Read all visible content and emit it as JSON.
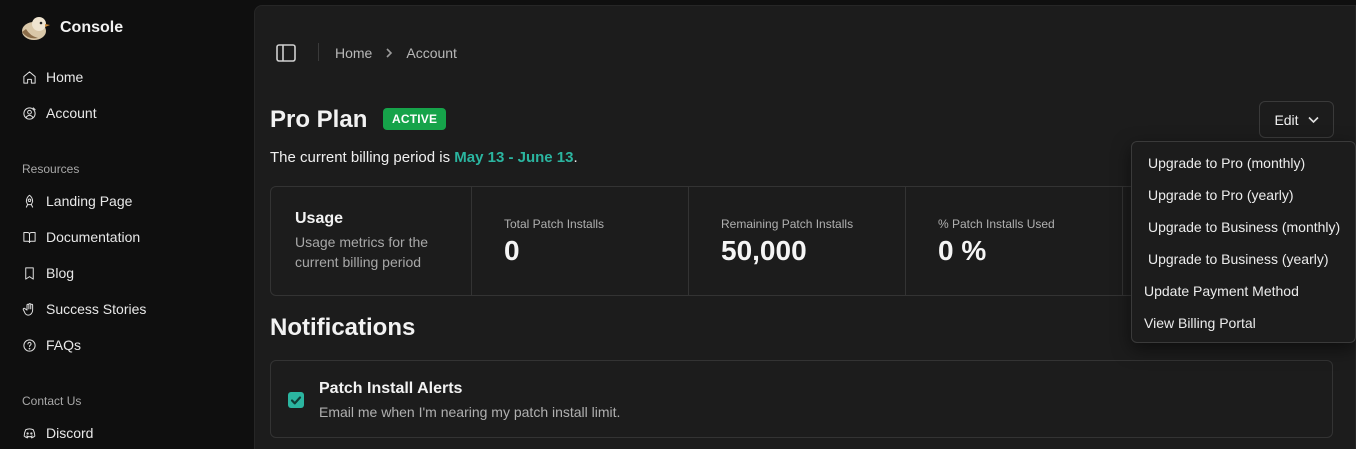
{
  "brand": {
    "name": "Console",
    "logo_icon": "bird-logo-icon"
  },
  "sidebar": {
    "primary": [
      {
        "label": "Home",
        "icon": "home-icon"
      },
      {
        "label": "Account",
        "icon": "account-icon"
      }
    ],
    "resources_label": "Resources",
    "resources": [
      {
        "label": "Landing Page",
        "icon": "rocket-icon"
      },
      {
        "label": "Documentation",
        "icon": "book-open-icon"
      },
      {
        "label": "Blog",
        "icon": "bookmark-icon"
      },
      {
        "label": "Success Stories",
        "icon": "hand-wave-icon"
      },
      {
        "label": "FAQs",
        "icon": "help-circle-icon"
      }
    ],
    "contact_label": "Contact Us",
    "contact": [
      {
        "label": "Discord",
        "icon": "discord-icon"
      }
    ]
  },
  "breadcrumb": {
    "items": [
      "Home",
      "Account"
    ]
  },
  "plan": {
    "title": "Pro Plan",
    "status": "ACTIVE",
    "billing_prefix": "The current billing period is ",
    "billing_dates": "May 13 - June 13",
    "billing_suffix": ".",
    "edit_label": "Edit"
  },
  "usage": {
    "title": "Usage",
    "description": "Usage metrics for the current billing period",
    "metrics": [
      {
        "label": "Total Patch Installs",
        "value": "0"
      },
      {
        "label": "Remaining Patch Installs",
        "value": "50,000"
      },
      {
        "label": "% Patch Installs Used",
        "value": "0 %"
      }
    ]
  },
  "notifications": {
    "title": "Notifications",
    "alert_title": "Patch Install Alerts",
    "alert_desc": "Email me when I'm nearing my patch install limit.",
    "alert_checked": true
  },
  "dropdown": {
    "items": [
      "Upgrade to Pro (monthly)",
      "Upgrade to Pro (yearly)",
      "Upgrade to Business (monthly)",
      "Upgrade to Business (yearly)",
      "Update Payment Method",
      "View Billing Portal"
    ]
  },
  "colors": {
    "accent": "#2bb5a0",
    "badge": "#16a34a",
    "background": "#0f0f0f",
    "panel": "#1c1c1c"
  }
}
